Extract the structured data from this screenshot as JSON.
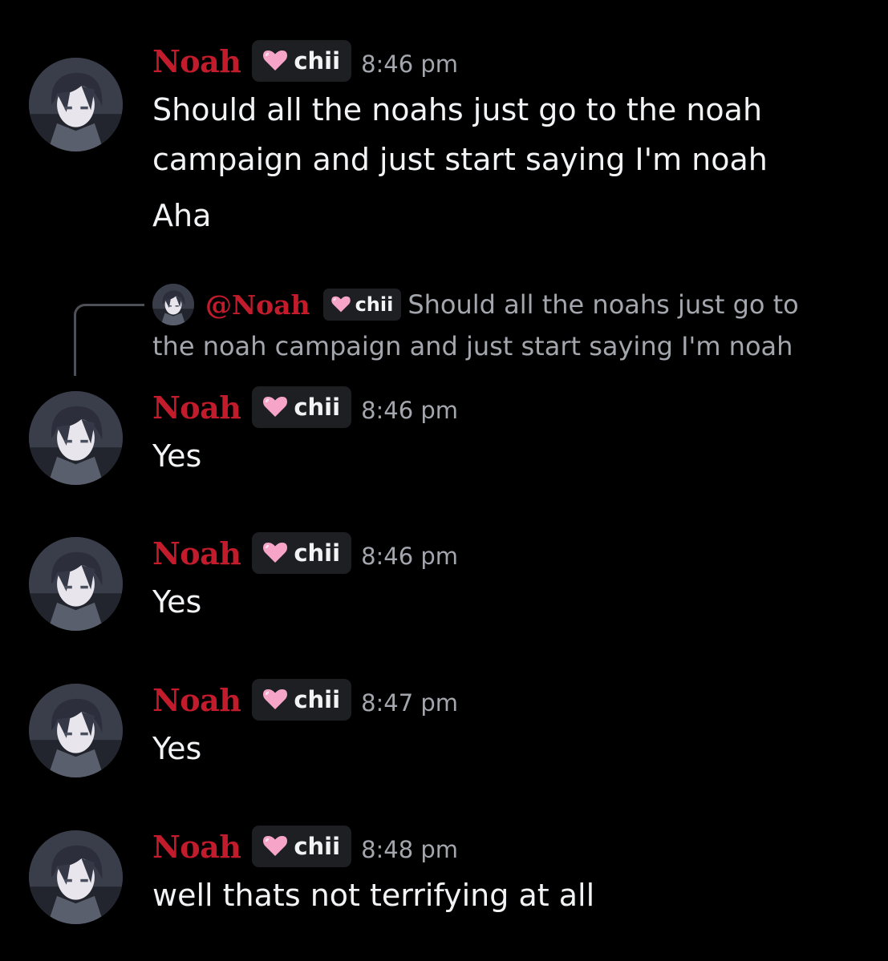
{
  "messages": [
    {
      "username": "Noah",
      "tag": "chii",
      "time": "8:46 pm",
      "lines": [
        "Should all the noahs just go to the noah campaign and just start saying I'm noah",
        "Aha"
      ]
    },
    {
      "username": "Noah",
      "tag": "chii",
      "time": "8:46 pm",
      "lines": [
        "Yes"
      ]
    },
    {
      "username": "Noah",
      "tag": "chii",
      "time": "8:46 pm",
      "lines": [
        "Yes"
      ]
    },
    {
      "username": "Noah",
      "tag": "chii",
      "time": "8:47 pm",
      "lines": [
        "Yes"
      ]
    },
    {
      "username": "Noah",
      "tag": "chii",
      "time": "8:48 pm",
      "lines": [
        "well thats not terrifying at all"
      ]
    }
  ],
  "reply": {
    "mention": "@Noah",
    "tag": "chii",
    "text_line1": "Should all the noahs just go to",
    "text_line2": "the noah campaign and just start saying I'm noah"
  },
  "colors": {
    "background": "#000000",
    "username": "#c21b2c",
    "message_text": "#f2f3f5",
    "timestamp": "#a3a6ad",
    "tag_background": "#1e1f22",
    "heart": "#f6a5c8"
  },
  "icons": {
    "tag_icon": "pink-heart-icon",
    "avatar": "anime-avatar"
  }
}
